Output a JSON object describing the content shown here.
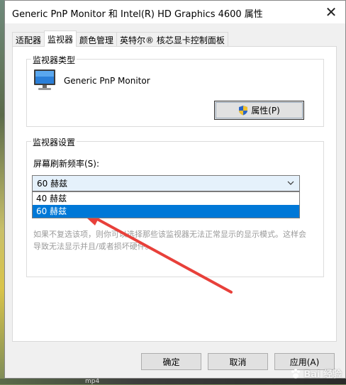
{
  "window": {
    "title": "Generic PnP Monitor 和 Intel(R) HD Graphics 4600 属性",
    "close_glyph": "✕"
  },
  "tabs": [
    {
      "label": "适配器",
      "active": false
    },
    {
      "label": "监视器",
      "active": true
    },
    {
      "label": "颜色管理",
      "active": false
    },
    {
      "label": "英特尔® 核芯显卡控制面板",
      "active": false
    }
  ],
  "monitor_type": {
    "group_label": "监视器类型",
    "monitor_name": "Generic PnP Monitor",
    "properties_button": "属性(P)",
    "icon": "monitor-icon"
  },
  "monitor_settings": {
    "group_label": "监视器设置",
    "refresh_label": "屏幕刷新频率(S):",
    "selected_value": "60 赫兹",
    "options": [
      "40 赫兹",
      "60 赫兹"
    ],
    "highlighted_option": "60 赫兹",
    "warning_text": "如果不复选该项，则你可以选择那些该监视器无法正常显示的显示模式。这样会导致无法显示并且/或者损坏硬件。"
  },
  "buttons": {
    "ok": "确定",
    "cancel": "取消",
    "apply": "应用(A)"
  },
  "taskbar_fragment": "mp4",
  "watermark": "Bai 经验",
  "colors": {
    "accent": "#0078d7",
    "arrow": "#e8403a",
    "shield_blue": "#2a64c5",
    "shield_yellow": "#f2c12e"
  }
}
